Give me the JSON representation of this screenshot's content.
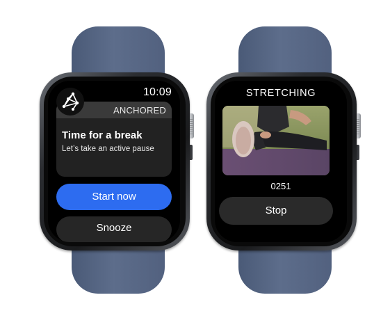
{
  "watch_left": {
    "time": "10:09",
    "app_name": "ANCHORED",
    "logo_icon": "anchored-constellation-logo",
    "notification": {
      "title": "Time for a break",
      "body": "Let’s take an active pause"
    },
    "primary_button": "Start now",
    "secondary_button": "Snooze"
  },
  "watch_right": {
    "title": "STRETCHING",
    "video_icon": "stretching-video",
    "counter": "0251",
    "stop_button": "Stop"
  },
  "colors": {
    "band": "#55647f",
    "primary": "#2d6cf0",
    "screen": "#000000",
    "card": "#222222"
  }
}
